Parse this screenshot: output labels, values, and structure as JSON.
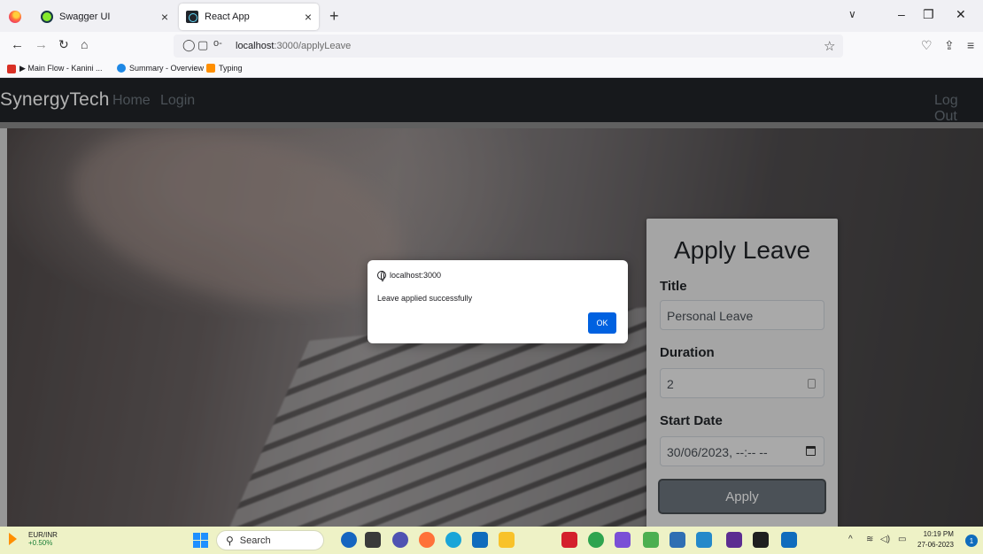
{
  "browser": {
    "tabs": [
      {
        "title": "Swagger UI",
        "icon": "swagger-icon",
        "active": false
      },
      {
        "title": "React App",
        "icon": "react-icon",
        "active": true
      }
    ],
    "url_host": "localhost",
    "url_path": ":3000/applyLeave",
    "bookmarks": [
      {
        "label": "▶ Main Flow - Kanini ...",
        "color": "#d93025"
      },
      {
        "label": "Summary - Overview",
        "color": "#1e88e5"
      },
      {
        "label": "Typing",
        "color": "#ff8f00"
      }
    ]
  },
  "app": {
    "brand": "SynergyTech",
    "nav": {
      "home": "Home",
      "login": "Login",
      "logout": "Log Out"
    }
  },
  "form": {
    "heading": "Apply Leave",
    "title_label": "Title",
    "title_value": "Personal Leave",
    "duration_label": "Duration",
    "duration_value": "2",
    "start_label": "Start Date",
    "start_value": "30/06/2023, --:-- --",
    "apply_label": "Apply"
  },
  "alert": {
    "origin": "localhost:3000",
    "message": "Leave applied successfully",
    "ok_label": "OK"
  },
  "taskbar": {
    "stock_name": "EUR/INR",
    "stock_change": "+0.50%",
    "search_placeholder": "Search",
    "time": "10:19 PM",
    "date": "27-06-2023",
    "notifications": "1"
  },
  "colors": {
    "navbar": "#212529",
    "accent": "#0061e0",
    "apply_button": "#6c757d"
  }
}
